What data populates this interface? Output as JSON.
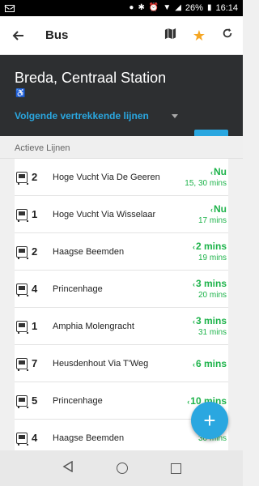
{
  "statusbar": {
    "battery": "26%",
    "time": "16:14"
  },
  "appbar": {
    "title": "Bus",
    "back_icon": "arrow-back-icon",
    "map_icon": "map-icon",
    "favorite_icon": "star-icon",
    "refresh_icon": "refresh-icon",
    "accent": "#f5a623"
  },
  "header": {
    "station": "Breda, Centraal Station",
    "accessible_icon": "wheelchair-icon",
    "dropdown_label": "Volgende vertrekkende lijnen",
    "brand_color": "#2aa7e0"
  },
  "section": {
    "label": "Actieve Lijnen"
  },
  "departures": [
    {
      "line": "2",
      "destination": "Hoge Vucht Via De Geeren",
      "next": "Nu",
      "later": "15, 30 mins"
    },
    {
      "line": "1",
      "destination": "Hoge Vucht Via Wisselaar",
      "next": "Nu",
      "later": "17 mins"
    },
    {
      "line": "2",
      "destination": "Haagse Beemden",
      "next": "2 mins",
      "later": "19 mins"
    },
    {
      "line": "4",
      "destination": "Princenhage",
      "next": "3 mins",
      "later": "20 mins"
    },
    {
      "line": "1",
      "destination": "Amphia Molengracht",
      "next": "3 mins",
      "later": "31 mins"
    },
    {
      "line": "7",
      "destination": "Heusdenhout Via T'Weg",
      "next": "6 mins",
      "later": ""
    },
    {
      "line": "5",
      "destination": "Princenhage",
      "next": "10 mins",
      "later": ""
    },
    {
      "line": "4",
      "destination": "Haagse Beemden",
      "next": "",
      "later": "30 mins"
    }
  ],
  "fab": {
    "label": "+"
  },
  "colors": {
    "realtime_green": "#1db34a"
  }
}
